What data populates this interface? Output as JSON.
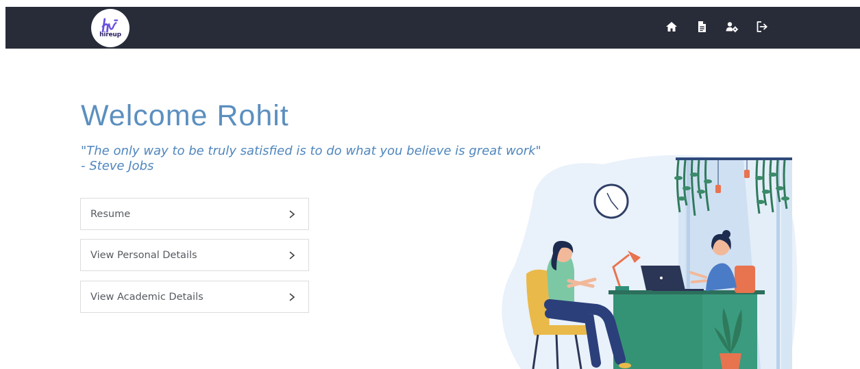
{
  "header": {
    "logo_text": "hireup",
    "nav_icons": [
      "home-icon",
      "document-icon",
      "user-settings-icon",
      "logout-icon"
    ]
  },
  "main": {
    "welcome": "Welcome Rohit",
    "quote_line1": "\"The only way to be truly satisfied is to do what you believe is great work\"",
    "quote_line2": "- Steve Jobs",
    "menu": [
      {
        "label": "Resume"
      },
      {
        "label": "View Personal Details"
      },
      {
        "label": "View Academic Details"
      }
    ]
  },
  "colors": {
    "navbar": "#282c39",
    "accent_text": "#5b8fbf",
    "desk": "#2f8f78"
  }
}
